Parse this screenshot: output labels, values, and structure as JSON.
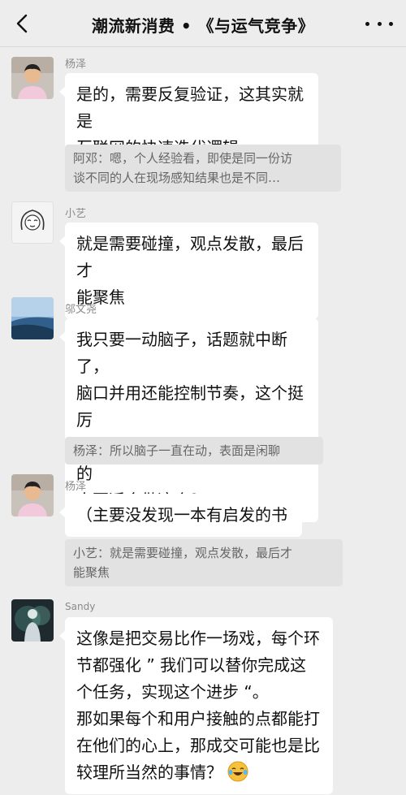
{
  "header": {
    "title": "潮流新消费 • 《与运气竞争》"
  },
  "messages": [
    {
      "sender": "杨泽",
      "lines": [
        "是的，需要反复验证，这其实就是",
        "互联网的快速迭代逻辑"
      ],
      "quote": [
        "阿邓：嗯，个人经验看，即使是同一份访",
        "谈不同的人在现场感知结果也是不同…"
      ]
    },
    {
      "sender": "小艺",
      "lines": [
        "就是需要碰撞，观点发散，最后才",
        "能聚焦"
      ]
    },
    {
      "sender": "邬文尧",
      "lines": [
        "我只要一动脑子，话题就中断了，",
        "脑口并用还能控制节奏，这个挺厉",
        "害。是不是喜欢聊天、有亲和力的",
        "人更适合做这个？"
      ],
      "quote": [
        "杨泽：所以脑子一直在动，表面是闲聊"
      ]
    },
    {
      "sender": "杨泽",
      "lines": [
        "（主要没发现一本有启发的书"
      ],
      "quote": [
        "小艺：就是需要碰撞，观点发散，最后才",
        "能聚焦"
      ]
    },
    {
      "sender": "Sandy",
      "lines": [
        "这像是把交易比作一场戏，每个环",
        "节都强化 ” 我们可以替你完成这",
        "个任务，实现这个进步 “。",
        "那如果每个和用户接触的点都能打",
        "在他们的心上，那成交可能也是比",
        "较理所当然的事情？"
      ]
    }
  ]
}
